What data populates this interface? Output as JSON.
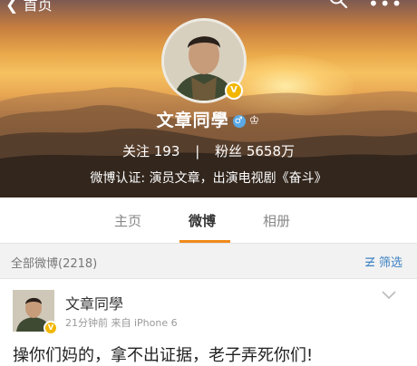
{
  "topbar": {
    "back_label": "首页"
  },
  "profile": {
    "name": "文章同學",
    "gender_symbol": "♂",
    "verified_badge": "V",
    "follow_label": "关注",
    "follow_count": "193",
    "separator": "|",
    "fans_label": "粉丝",
    "fans_count": "5658万",
    "verify_text": "微博认证: 演员文章，出演电视剧《奋斗》"
  },
  "tabs": [
    {
      "label": "主页"
    },
    {
      "label": "微博"
    },
    {
      "label": "相册"
    }
  ],
  "filterbar": {
    "count_text": "全部微博(2218)",
    "filter_label": "筛选"
  },
  "post": {
    "author": "文章同學",
    "time": "21分钟前",
    "source": "来自 iPhone 6",
    "text": "操你们妈的，拿不出证据，老子弄死你们!"
  },
  "colors": {
    "accent": "#f08a1b",
    "link": "#3e82c4",
    "verified": "#f2b600"
  }
}
